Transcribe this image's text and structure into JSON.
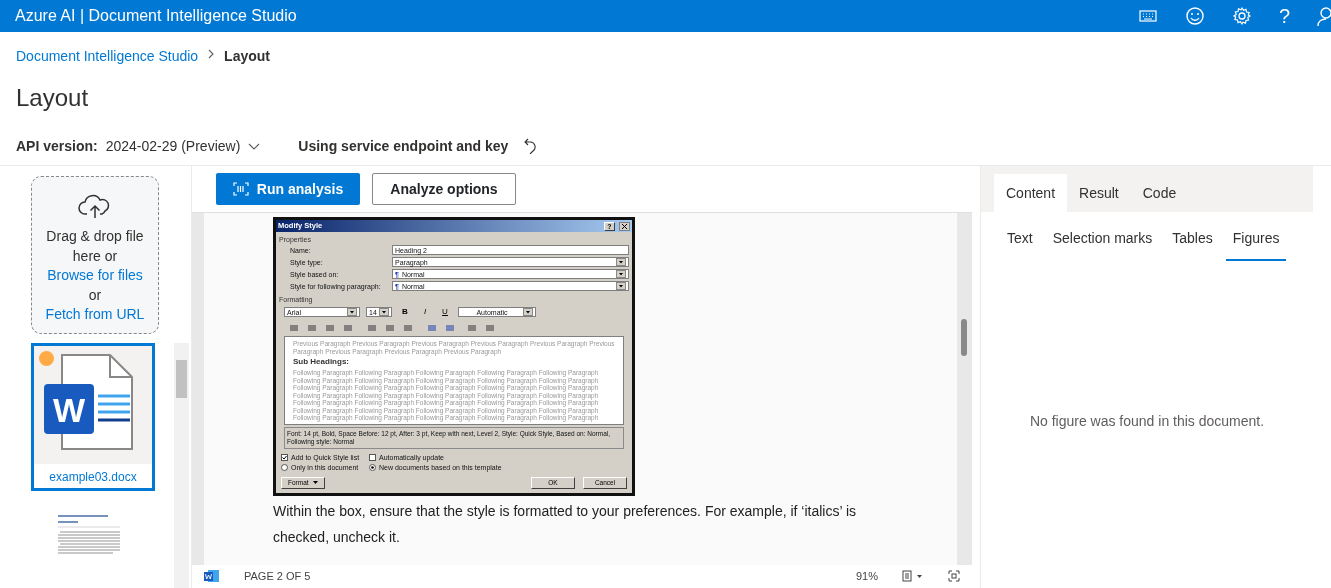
{
  "header": {
    "title": "Azure AI | Document Intelligence Studio",
    "help": "?"
  },
  "breadcrumb": [
    {
      "label": "Document Intelligence Studio",
      "current": false
    },
    {
      "label": "Layout",
      "current": true
    }
  ],
  "page_title": "Layout",
  "api_version": {
    "label": "API version:",
    "value": "2024-02-29 (Preview)"
  },
  "endpoint": "Using service endpoint and key",
  "upload": [
    {
      "kind": "text",
      "text": "Drag & drop file here or"
    },
    {
      "kind": "link",
      "text": "Browse for files"
    },
    {
      "kind": "text",
      "text": "or"
    },
    {
      "kind": "link",
      "text": "Fetch from URL"
    }
  ],
  "files": [
    {
      "kind": "word",
      "name": "example03.docx",
      "letter": "W",
      "selected": true,
      "dot": true
    },
    {
      "kind": "page",
      "selected": false,
      "dot": false
    }
  ],
  "toolbar": {
    "run": "Run analysis",
    "options": "Analyze options"
  },
  "dialog": {
    "title": "Modify Style",
    "help": "?",
    "properties_label": "Properties",
    "fields": [
      {
        "kind": "text",
        "label": "Name:",
        "value": "Heading 2"
      },
      {
        "kind": "select",
        "label": "Style type:",
        "value": "Paragraph"
      },
      {
        "kind": "select",
        "label": "Style based on:",
        "icon": "¶",
        "value": "Normal"
      },
      {
        "kind": "select",
        "label": "Style for following paragraph:",
        "icon": "¶",
        "value": "Normal"
      }
    ],
    "formatting_label": "Formatting",
    "font": "Arial",
    "size": "14",
    "style_buttons": [
      {
        "kind": "bold",
        "label": "B"
      },
      {
        "kind": "italic",
        "label": "I"
      },
      {
        "kind": "underline",
        "label": "U"
      }
    ],
    "swatch_label": "Automatic",
    "preview": {
      "before": "Previous Paragraph Previous Paragraph Previous Paragraph Previous Paragraph Previous Paragraph Previous Paragraph Previous Paragraph Previous Paragraph Previous Paragraph",
      "heading": "Sub Headings:",
      "after": "Following Paragraph Following Paragraph Following Paragraph Following Paragraph Following Paragraph Following Paragraph Following Paragraph Following Paragraph Following Paragraph Following Paragraph Following Paragraph Following Paragraph Following Paragraph Following Paragraph Following Paragraph Following Paragraph Following Paragraph Following Paragraph Following Paragraph Following Paragraph Following Paragraph Following Paragraph Following Paragraph Following Paragraph Following Paragraph Following Paragraph Following Paragraph Following Paragraph Following Paragraph Following Paragraph Following Paragraph Following Paragraph Following Paragraph Following Paragraph Following Paragraph"
    },
    "description": "Font: 14 pt, Bold, Space Before:  12 pt, After:  3 pt, Keep with next, Level 2, Style: Quick Style, Based on: Normal, Following style: Normal",
    "options": [
      {
        "kind": "checkbox",
        "label": "Add to Quick Style list",
        "checked": true
      },
      {
        "kind": "checkbox",
        "label": "Automatically update",
        "checked": false
      },
      {
        "kind": "radio",
        "label": "Only in this document",
        "checked": false
      },
      {
        "kind": "radio",
        "label": "New documents based on this template",
        "checked": true
      }
    ],
    "format_button": "Format",
    "ok": "OK",
    "cancel": "Cancel"
  },
  "paragraph": "Within the box, ensure that the style is formatted to your preferences. For example, if ‘italics’ is checked, uncheck it.",
  "viewer_status": {
    "page": "PAGE 2 OF 5",
    "zoom": "91%"
  },
  "panel": {
    "tabs": [
      {
        "label": "Content",
        "selected": true
      },
      {
        "label": "Result",
        "selected": false
      },
      {
        "label": "Code",
        "selected": false
      }
    ],
    "subtabs": [
      {
        "label": "Text",
        "selected": false
      },
      {
        "label": "Selection marks",
        "selected": false
      },
      {
        "label": "Tables",
        "selected": false
      },
      {
        "label": "Figures",
        "selected": true
      }
    ],
    "message": "No figure was found in this document."
  }
}
